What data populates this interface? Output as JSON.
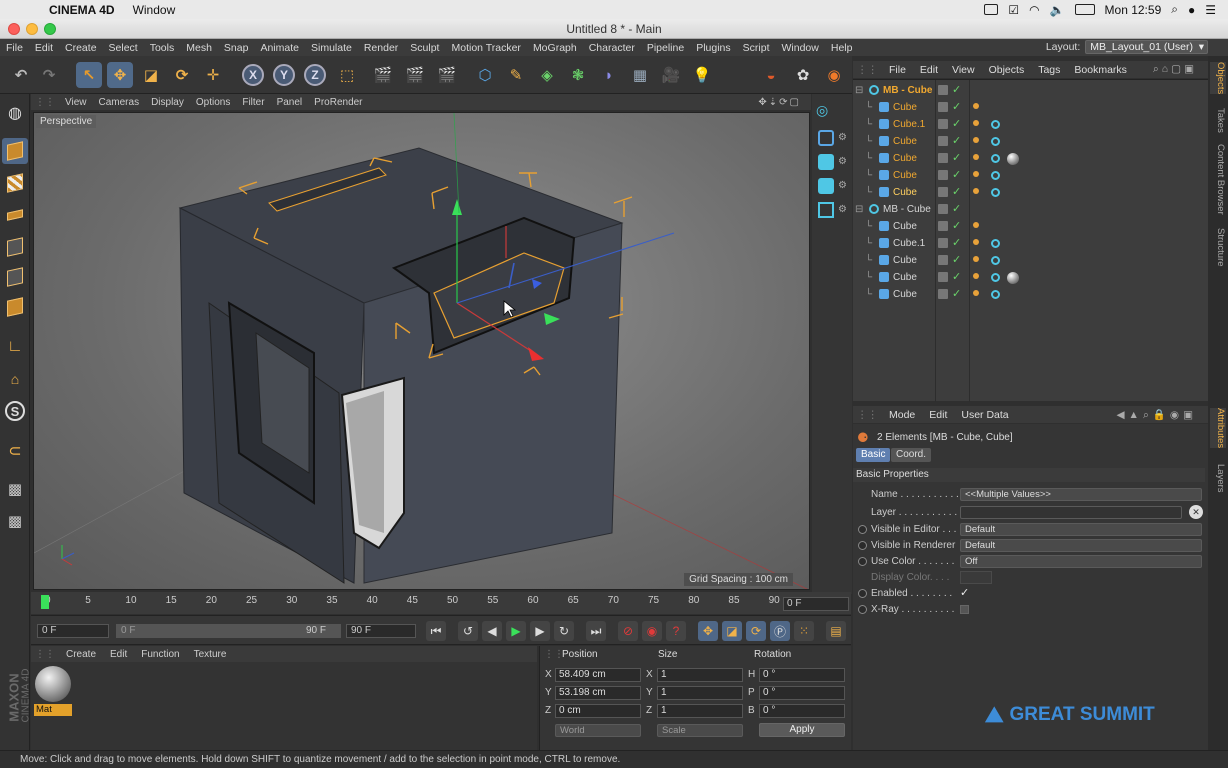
{
  "mac_menubar": {
    "app_name": "CINEMA 4D",
    "menu": [
      "Window"
    ],
    "clock": "Mon 12:59"
  },
  "window": {
    "title": "Untitled 8 * - Main"
  },
  "app_menu": {
    "items": [
      "File",
      "Edit",
      "Create",
      "Select",
      "Tools",
      "Mesh",
      "Snap",
      "Animate",
      "Simulate",
      "Render",
      "Sculpt",
      "Motion Tracker",
      "MoGraph",
      "Character",
      "Pipeline",
      "Plugins",
      "Script",
      "Window",
      "Help"
    ],
    "layout_label": "Layout:",
    "layout_value": "MB_Layout_01 (User)"
  },
  "toolbar": {
    "axis_x": "X",
    "axis_y": "Y",
    "axis_z": "Z"
  },
  "viewport": {
    "menu": [
      "View",
      "Cameras",
      "Display",
      "Options",
      "Filter",
      "Panel",
      "ProRender"
    ],
    "camera_label": "Perspective",
    "grid_spacing": "Grid Spacing : 100 cm"
  },
  "timeline": {
    "ticks": [
      "0",
      "5",
      "10",
      "15",
      "20",
      "25",
      "30",
      "35",
      "40",
      "45",
      "50",
      "55",
      "60",
      "65",
      "70",
      "75",
      "80",
      "85",
      "90"
    ],
    "current_frame": "0 F"
  },
  "transport": {
    "start_field": "0 F",
    "range_start": "0 F",
    "range_end": "90 F",
    "end_field": "90 F"
  },
  "material_panel": {
    "menu": [
      "Create",
      "Edit",
      "Function",
      "Texture"
    ],
    "material_name": "Mat"
  },
  "coordinates": {
    "headers": {
      "position": "Position",
      "size": "Size",
      "rotation": "Rotation"
    },
    "rows": [
      {
        "axis": "X",
        "position": "58.409 cm",
        "size_axis": "X",
        "size": "1",
        "rot_axis": "H",
        "rotation": "0 °"
      },
      {
        "axis": "Y",
        "position": "53.198 cm",
        "size_axis": "Y",
        "size": "1",
        "rot_axis": "P",
        "rotation": "0 °"
      },
      {
        "axis": "Z",
        "position": "0 cm",
        "size_axis": "Z",
        "size": "1",
        "rot_axis": "B",
        "rotation": "0 °"
      }
    ],
    "mode_world": "World",
    "mode_scale": "Scale",
    "apply_label": "Apply"
  },
  "objects_panel": {
    "menu": [
      "File",
      "Edit",
      "View",
      "Objects",
      "Tags",
      "Bookmarks"
    ],
    "objects": [
      {
        "name": "MB - Cube",
        "level": 0,
        "selected": true,
        "tags": "null"
      },
      {
        "name": "Cube",
        "level": 1,
        "selected": true,
        "tags": "p"
      },
      {
        "name": "Cube.1",
        "level": 1,
        "selected": true,
        "tags": "pc"
      },
      {
        "name": "Cube",
        "level": 1,
        "selected": true,
        "tags": "pc"
      },
      {
        "name": "Cube",
        "level": 1,
        "selected": true,
        "tags": "pcm"
      },
      {
        "name": "Cube",
        "level": 1,
        "selected": true,
        "tags": "pc"
      },
      {
        "name": "Cube",
        "level": 1,
        "selected": true,
        "tags": "pc"
      },
      {
        "name": "MB - Cube",
        "level": 0,
        "selected": false,
        "tags": "null"
      },
      {
        "name": "Cube",
        "level": 1,
        "selected": false,
        "tags": "p"
      },
      {
        "name": "Cube.1",
        "level": 1,
        "selected": false,
        "tags": "pc"
      },
      {
        "name": "Cube",
        "level": 1,
        "selected": false,
        "tags": "pc"
      },
      {
        "name": "Cube",
        "level": 1,
        "selected": false,
        "tags": "pcm"
      },
      {
        "name": "Cube",
        "level": 1,
        "selected": false,
        "tags": "pc"
      }
    ]
  },
  "attributes_panel": {
    "menu": [
      "Mode",
      "Edit",
      "User Data"
    ],
    "selection_title": "2 Elements [MB - Cube, Cube]",
    "tabs": [
      "Basic",
      "Coord."
    ],
    "section_title": "Basic Properties",
    "fields": [
      {
        "label": "Name . . . . . . . . . . .",
        "value": "<<Multiple Values>>"
      },
      {
        "label": "Layer . . . . . . . . . . .",
        "value": ""
      },
      {
        "label": "Visible in Editor . . .",
        "value": "Default"
      },
      {
        "label": "Visible in Renderer",
        "value": "Default"
      },
      {
        "label": "Use Color . . . . . . .",
        "value": "Off"
      },
      {
        "label": "Display Color. . . . ",
        "value": ""
      },
      {
        "label": "Enabled . . . . . . . .",
        "value": "✓"
      },
      {
        "label": "X-Ray . . . . . . . . . .",
        "value": ""
      }
    ]
  },
  "right_tabs": [
    "Objects",
    "Takes",
    "Content Browser",
    "Structure",
    "Attributes",
    "Layers"
  ],
  "status_bar": {
    "text": "Move: Click and drag to move elements. Hold down SHIFT to quantize movement / add to the selection in point mode, CTRL to remove."
  },
  "branding": {
    "side_logo_1": "MAXON",
    "side_logo_2": "CINEMA 4D",
    "watermark": "GREAT SUMMIT"
  },
  "colors": {
    "accent_blue": "#4f6787",
    "selection_orange": "#e3a12a",
    "object_icon_blue": "#5aa7e6"
  }
}
